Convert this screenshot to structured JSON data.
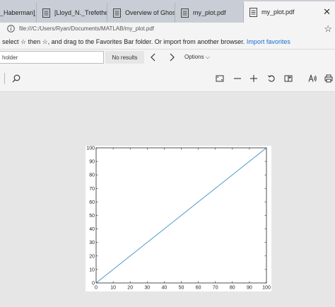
{
  "tabs": [
    {
      "label": "_Haberman]_Ap"
    },
    {
      "label": "[Lloyd_N._Trefethen,_Da"
    },
    {
      "label": "Overview of Ghostscrip"
    },
    {
      "label": "my_plot.pdf"
    },
    {
      "label": "my_plot.pdf",
      "active": true
    }
  ],
  "address": {
    "url": "file:///C:/Users/Ryan/Documents/MATLAB/my_plot.pdf"
  },
  "favorites_bar": {
    "message": "select ☆ then ☆, and drag to the Favorites Bar folder. Or import from another browser.",
    "link": "Import favorites"
  },
  "find": {
    "placeholder": "holder",
    "results": "No results",
    "options_label": "Options ⌵"
  },
  "icons": {
    "info": "info-icon",
    "favorite": "favorite-star-icon",
    "close": "close-tab-icon",
    "search": "search-icon",
    "fit": "fit-page-icon",
    "zoom_out": "zoom-out-icon",
    "zoom_in": "zoom-in-icon",
    "rotate": "rotate-icon",
    "page_view": "page-view-icon",
    "read_aloud": "read-aloud-icon",
    "print": "print-icon"
  },
  "colors": {
    "line": "#3d8fc6",
    "tabbar": "#c9ced6",
    "link": "#1a6dd1"
  },
  "chart_data": {
    "type": "line",
    "series": [
      {
        "x": [
          0,
          100
        ],
        "y": [
          0,
          100
        ]
      }
    ],
    "xlim": [
      0,
      100
    ],
    "ylim": [
      0,
      100
    ],
    "xticks": [
      0,
      10,
      20,
      30,
      40,
      50,
      60,
      70,
      80,
      90,
      100
    ],
    "yticks": [
      0,
      10,
      20,
      30,
      40,
      50,
      60,
      70,
      80,
      90,
      100
    ],
    "grid": false
  }
}
